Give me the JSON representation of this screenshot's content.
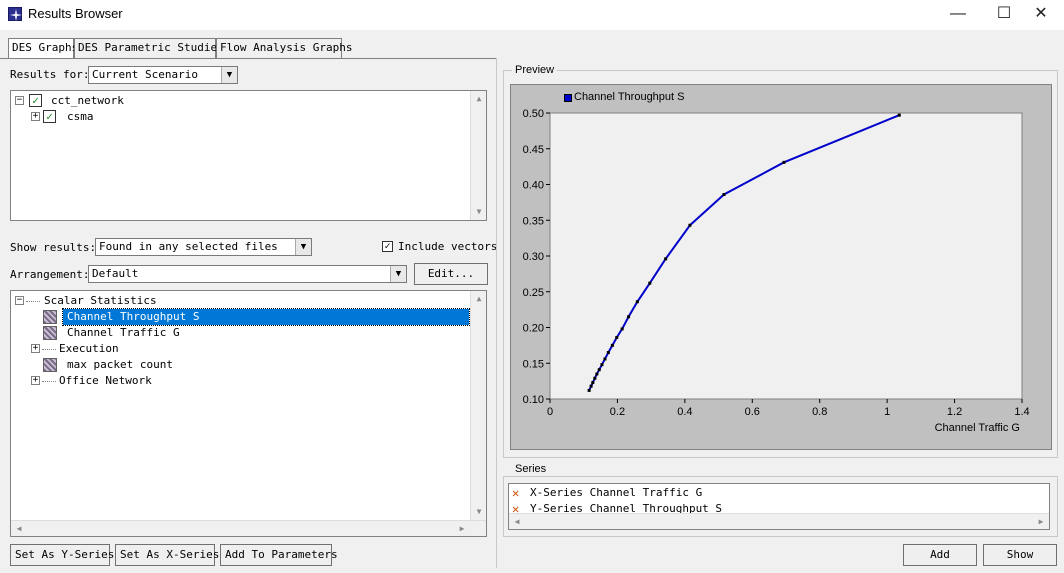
{
  "window": {
    "title": "Results Browser",
    "minimize": "—",
    "maximize": "☐",
    "close": "✕"
  },
  "tabs": [
    "DES Graphs",
    "DES Parametric Studies",
    "Flow Analysis Graphs"
  ],
  "results_for": {
    "label": "Results for:",
    "value": "Current Scenario"
  },
  "scenario_tree": [
    {
      "label": "cct_network",
      "checked": true
    },
    {
      "label": "csma",
      "checked": true
    }
  ],
  "show_results": {
    "label": "Show results:",
    "value": "Found in any selected files"
  },
  "include_vectors": {
    "label": "Include vectors",
    "checked": true
  },
  "arrangement": {
    "label": "Arrangement:",
    "value": "Default",
    "edit_button": "Edit..."
  },
  "stats_tree": {
    "root": "Scalar Statistics",
    "items": [
      "Channel Throughput S",
      "Channel Traffic G",
      "Execution",
      "max packet count",
      "Office Network"
    ],
    "selected": "Channel Throughput S"
  },
  "bottom_buttons": [
    "Set As Y-Series",
    "Set As X-Series",
    "Add To Parameters"
  ],
  "preview": {
    "group_title": "Preview"
  },
  "series": {
    "group_title": "Series",
    "rows": [
      {
        "label": "X-Series Channel Traffic G"
      },
      {
        "label": "Y-Series Channel Throughput S"
      }
    ]
  },
  "action_buttons": {
    "add": "Add",
    "show": "Show"
  },
  "chart_data": {
    "type": "line",
    "title": "",
    "xlabel": "Channel Traffic G",
    "ylabel": "",
    "xlim": [
      0,
      1.4
    ],
    "ylim": [
      0.1,
      0.5
    ],
    "x_ticks": [
      "0",
      "0.2",
      "0.4",
      "0.6",
      "0.8",
      "1",
      "1.2",
      "1.4"
    ],
    "y_ticks": [
      "0.10",
      "0.15",
      "0.20",
      "0.25",
      "0.30",
      "0.35",
      "0.40",
      "0.45",
      "0.50"
    ],
    "grid": false,
    "legend": "top-left",
    "series": [
      {
        "name": "Channel Throughput S",
        "color": "#0000cc",
        "x": [
          0.116,
          0.122,
          0.127,
          0.133,
          0.139,
          0.146,
          0.154,
          0.163,
          0.173,
          0.185,
          0.198,
          0.214,
          0.233,
          0.259,
          0.296,
          0.343,
          0.415,
          0.516,
          0.694,
          1.036
        ],
        "y": [
          0.112,
          0.118,
          0.123,
          0.129,
          0.135,
          0.141,
          0.148,
          0.156,
          0.165,
          0.175,
          0.186,
          0.198,
          0.215,
          0.236,
          0.262,
          0.296,
          0.343,
          0.386,
          0.431,
          0.497
        ]
      }
    ]
  }
}
